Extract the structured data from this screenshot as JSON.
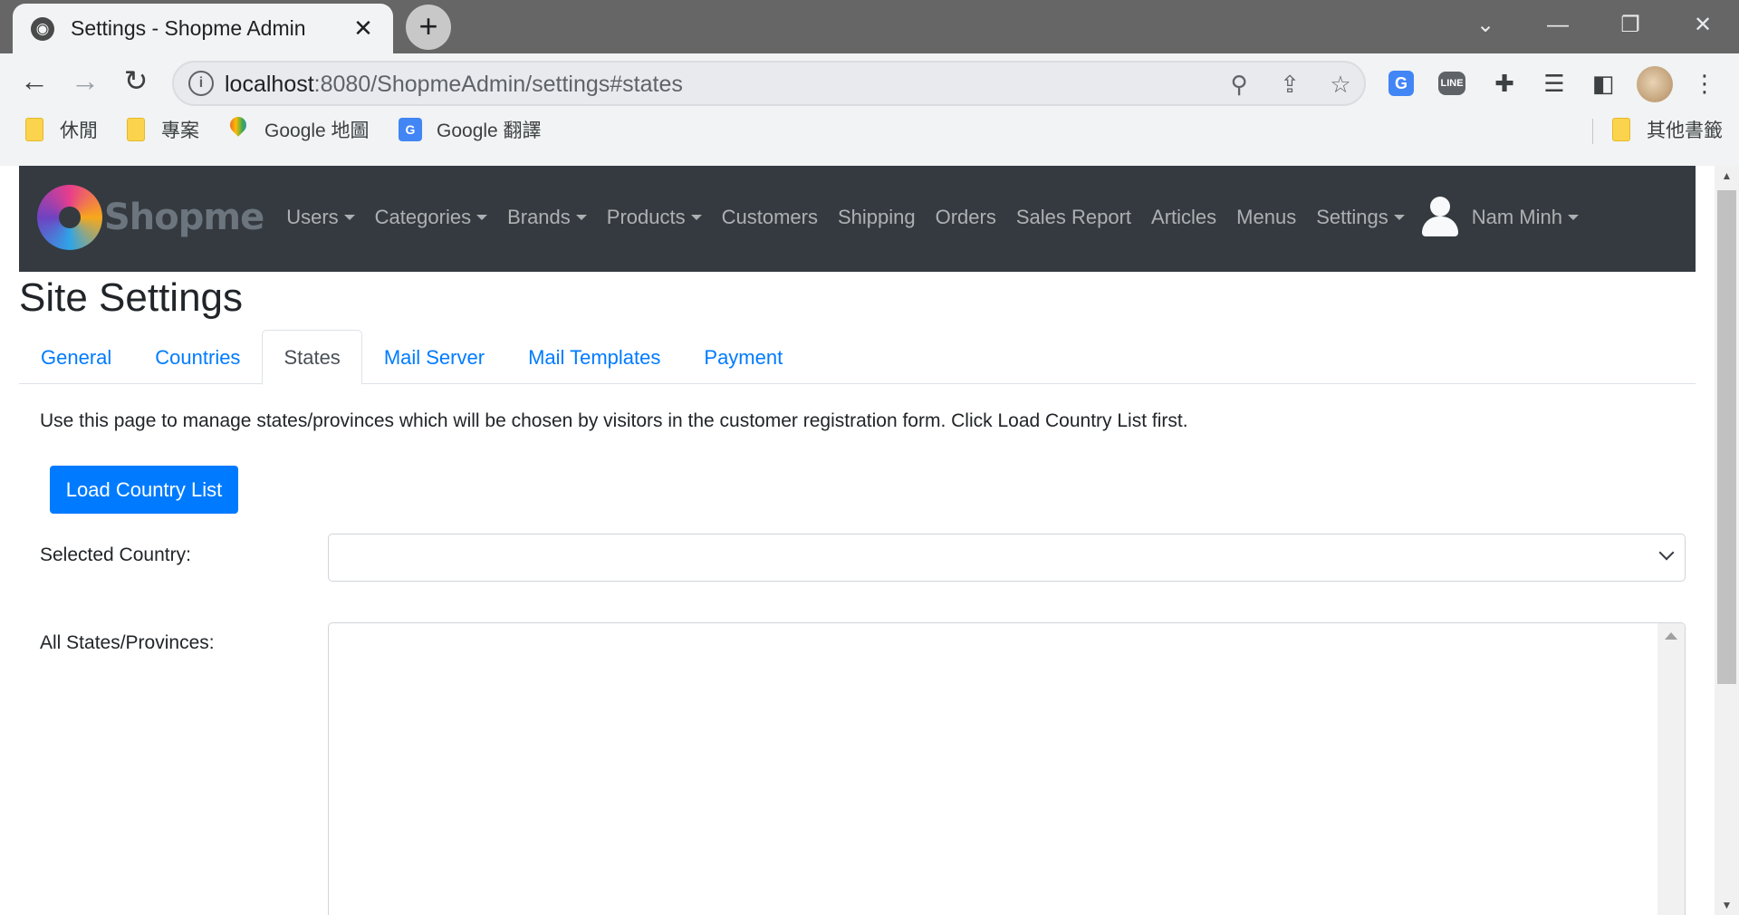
{
  "browser": {
    "tab_title": "Settings - Shopme Admin",
    "tab_close": "✕",
    "new_tab": "+",
    "url_host": "localhost",
    "url_rest": ":8080/ShopmeAdmin/settings#states",
    "bookmarks": [
      {
        "label": "休閒",
        "icon": "folder-icon"
      },
      {
        "label": "專案",
        "icon": "folder-icon"
      },
      {
        "label": "Google 地圖",
        "icon": "google-maps-icon"
      },
      {
        "label": "Google 翻譯",
        "icon": "google-translate-icon"
      }
    ],
    "other_bookmarks": "其他書籤"
  },
  "navbar": {
    "brand": "Shopme",
    "items": [
      {
        "label": "Users",
        "dropdown": true
      },
      {
        "label": "Categories",
        "dropdown": true
      },
      {
        "label": "Brands",
        "dropdown": true
      },
      {
        "label": "Products",
        "dropdown": true
      },
      {
        "label": "Customers",
        "dropdown": false
      },
      {
        "label": "Shipping",
        "dropdown": false
      },
      {
        "label": "Orders",
        "dropdown": false
      },
      {
        "label": "Sales Report",
        "dropdown": false
      },
      {
        "label": "Articles",
        "dropdown": false
      },
      {
        "label": "Menus",
        "dropdown": false
      },
      {
        "label": "Settings",
        "dropdown": true
      }
    ],
    "user_name": "Nam Minh"
  },
  "page": {
    "title": "Site Settings",
    "tabs": [
      "General",
      "Countries",
      "States",
      "Mail Server",
      "Mail Templates",
      "Payment"
    ],
    "active_tab": "States",
    "intro": "Use this page to manage states/provinces which will be chosen by visitors in the customer registration form. Click Load Country List first.",
    "load_button": "Load Country List",
    "selected_country_label": "Selected Country:",
    "selected_country_value": "",
    "states_label": "All States/Provinces:"
  },
  "colors": {
    "navbar_bg": "#343a40",
    "link": "#007bff",
    "button_primary": "#007bff"
  }
}
